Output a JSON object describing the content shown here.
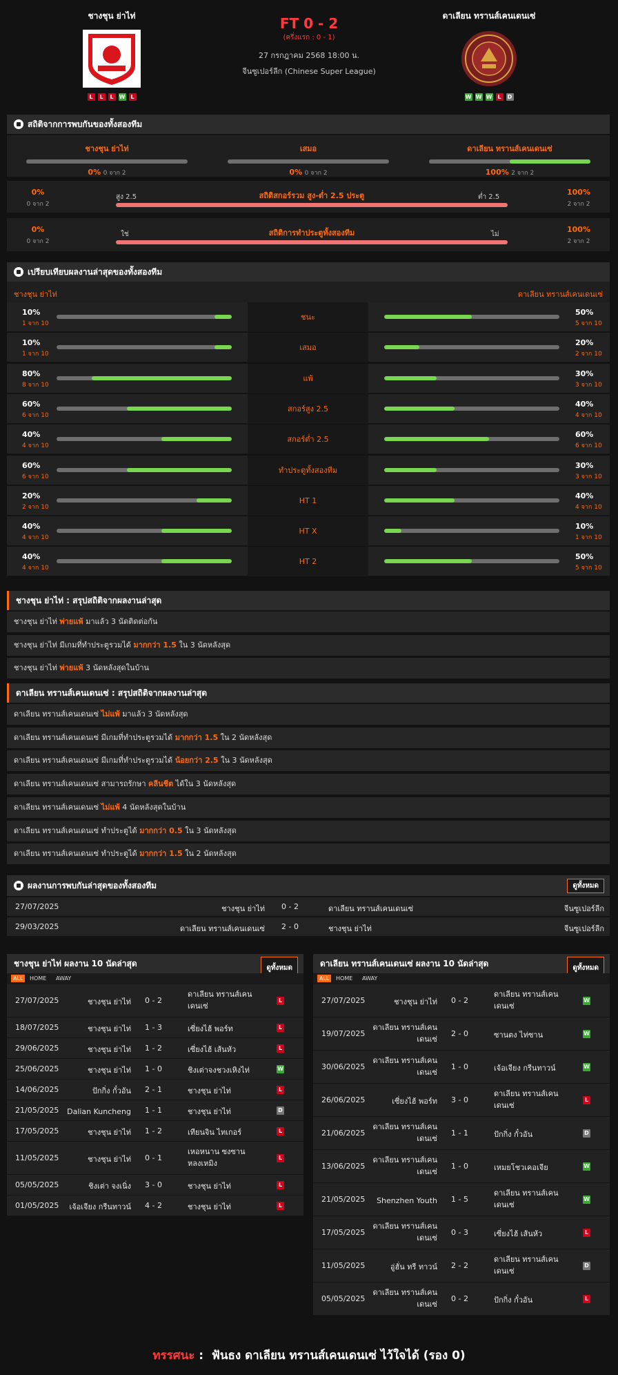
{
  "header": {
    "home": "ชางชุน ย่าไท่",
    "away": "ดาเลียน ทรานส์เคนเดนเซ่",
    "score": "FT 0 - 2",
    "half": "(ครึ่งแรก : 0 - 1)",
    "date": "27 กรกฎาคม 2568 18:00 น.",
    "league": "จีนซูเปอร์ลีก (Chinese Super League)",
    "home_form": [
      "L",
      "L",
      "L",
      "W",
      "L"
    ],
    "away_form": [
      "W",
      "W",
      "W",
      "L",
      "D"
    ],
    "home_logo_text": "CHANGCHUN YATAI FOOTBALL CLUB · 长春亚泰 · 1996",
    "away_logo_text": "大连英博海发足球俱乐部 · DALIAN YINGBO FC · 2021"
  },
  "h2h_stats": {
    "title": "สถิติจากการพบกันของทั้งสองทีม",
    "home": "ชางชุน ย่าไท่",
    "draw": "เสมอ",
    "away": "ดาเลียน ทรานส์เคนเดนเซ่",
    "home_pct": "0%",
    "home_sub": "0 จาก 2",
    "draw_pct": "0%",
    "draw_sub": "0 จาก 2",
    "away_pct": "100%",
    "away_sub": "2 จาก 2",
    "home_val": 0,
    "draw_val": 0,
    "away_val": 1,
    "ou_title": "สถิติสกอร์รวม สูง-ต่ำ 2.5 ประตู",
    "ou_left": "สูง 2.5",
    "ou_right": "ต่ำ 2.5",
    "ou_lpct": "0%",
    "ou_lsub": "0 จาก 2",
    "ou_rpct": "100%",
    "ou_rsub": "2 จาก 2",
    "ou_val": 1,
    "bt_title": "สถิติการทำประตูทั้งสองทีม",
    "bt_left": "ใช่",
    "bt_right": "ไม่",
    "bt_lpct": "0%",
    "bt_lsub": "0 จาก 2",
    "bt_rpct": "100%",
    "bt_rsub": "2 จาก 2",
    "bt_val": 1
  },
  "compare": {
    "title": "เปรียบเทียบผลงานล่าสุดของทั้งสองทีม",
    "home": "ชางชุน ย่าไท่",
    "away": "ดาเลียน ทรานส์เคนเดนเซ่",
    "rows": [
      {
        "label": "ชนะ",
        "lp": "10%",
        "ls": "1 จาก 10",
        "rp": "50%",
        "rs": "5 จาก 10",
        "lv": 0.1,
        "rv": 0.5
      },
      {
        "label": "เสมอ",
        "lp": "10%",
        "ls": "1 จาก 10",
        "rp": "20%",
        "rs": "2 จาก 10",
        "lv": 0.1,
        "rv": 0.2
      },
      {
        "label": "แพ้",
        "lp": "80%",
        "ls": "8 จาก 10",
        "rp": "30%",
        "rs": "3 จาก 10",
        "lv": 0.8,
        "rv": 0.3
      },
      {
        "label": "สกอร์สูง 2.5",
        "lp": "60%",
        "ls": "6 จาก 10",
        "rp": "40%",
        "rs": "4 จาก 10",
        "lv": 0.6,
        "rv": 0.4
      },
      {
        "label": "สกอร์ต่ำ 2.5",
        "lp": "40%",
        "ls": "4 จาก 10",
        "rp": "60%",
        "rs": "6 จาก 10",
        "lv": 0.4,
        "rv": 0.6
      },
      {
        "label": "ทำประตูทั้งสองทีม",
        "lp": "60%",
        "ls": "6 จาก 10",
        "rp": "30%",
        "rs": "3 จาก 10",
        "lv": 0.6,
        "rv": 0.3
      },
      {
        "label": "HT 1",
        "lp": "20%",
        "ls": "2 จาก 10",
        "rp": "40%",
        "rs": "4 จาก 10",
        "lv": 0.2,
        "rv": 0.4
      },
      {
        "label": "HT X",
        "lp": "40%",
        "ls": "4 จาก 10",
        "rp": "10%",
        "rs": "1 จาก 10",
        "lv": 0.4,
        "rv": 0.1
      },
      {
        "label": "HT 2",
        "lp": "40%",
        "ls": "4 จาก 10",
        "rp": "50%",
        "rs": "5 จาก 10",
        "lv": 0.4,
        "rv": 0.5
      }
    ]
  },
  "home_summary": {
    "title": "ชางชุน ย่าไท่ : สรุปสถิติจากผลงานล่าสุด",
    "rows": [
      [
        "ชางชุน ย่าไท่ ",
        "พ่ายแพ้",
        " มาแล้ว 3 นัดติดต่อกัน"
      ],
      [
        "ชางชุน ย่าไท่ มีเกมที่ทำประตูรวมได้ ",
        "มากกว่า 1.5",
        " ใน 3 นัดหลังสุด"
      ],
      [
        "ชางชุน ย่าไท่ ",
        "พ่ายแพ้",
        " 3 นัดหลังสุดในบ้าน"
      ]
    ]
  },
  "away_summary": {
    "title": "ดาเลียน ทรานส์เคนเดนเซ่ : สรุปสถิติจากผลงานล่าสุด",
    "rows": [
      [
        "ดาเลียน ทรานส์เคนเดนเซ่ ",
        "ไม่แพ้",
        " มาแล้ว 3 นัดหลังสุด"
      ],
      [
        "ดาเลียน ทรานส์เคนเดนเซ่ มีเกมที่ทำประตูรวมได้ ",
        "มากกว่า 1.5",
        " ใน 2 นัดหลังสุด"
      ],
      [
        "ดาเลียน ทรานส์เคนเดนเซ่ มีเกมที่ทำประตูรวมได้ ",
        "น้อยกว่า 2.5",
        " ใน 3 นัดหลังสุด"
      ],
      [
        "ดาเลียน ทรานส์เคนเดนเซ่ สามารถรักษา ",
        "คลีนชีต",
        " ได้ใน 3 นัดหลังสุด"
      ],
      [
        "ดาเลียน ทรานส์เคนเดนเซ่ ",
        "ไม่แพ้",
        " 4 นัดหลังสุดในบ้าน"
      ],
      [
        "ดาเลียน ทรานส์เคนเดนเซ่ ทำประตูได้ ",
        "มากกว่า 0.5",
        " ใน 3 นัดหลังสุด"
      ],
      [
        "ดาเลียน ทรานส์เคนเดนเซ่ ทำประตูได้ ",
        "มากกว่า 1.5",
        " ใน 2 นัดหลังสุด"
      ]
    ]
  },
  "h2h": {
    "title": "ผลงานการพบกันล่าสุดของทั้งสองทีม",
    "view_all": "ดูทั้งหมด",
    "rows": [
      [
        "27/07/2025",
        "ชางชุน ย่าไท่",
        "0 - 2",
        "ดาเลียน ทรานส์เคนเดนเซ่",
        "จีนซูเปอร์ลีก"
      ],
      [
        "29/03/2025",
        "ดาเลียน ทรานส์เคนเดนเซ่",
        "2 - 0",
        "ชางชุน ย่าไท่",
        "จีนซูเปอร์ลีก"
      ]
    ]
  },
  "tabs": [
    "ALL",
    "HOME",
    "AWAY"
  ],
  "home_last": {
    "title": "ชางชุน ย่าไท่ ผลงาน 10 นัดล่าสุด",
    "view_all": "ดูทั้งหมด",
    "rows": [
      [
        "27/07/2025",
        "ชางชุน ย่าไท่",
        "0 - 2",
        "ดาเลียน ทรานส์เคน|เดนเซ่",
        "L"
      ],
      [
        "18/07/2025",
        "ชางชุน ย่าไท่",
        "1 - 3",
        "เซี่ยงไฮ้ พอร์ท",
        "L"
      ],
      [
        "29/06/2025",
        "ชางชุน ย่าไท่",
        "1 - 2",
        "เซี่ยงไฮ้ เส้นหัว",
        "L"
      ],
      [
        "25/06/2025",
        "ชางชุน ย่าไท่",
        "1 - 0",
        "ชิงเต่าจงชวงเหิงไท่",
        "W"
      ],
      [
        "14/06/2025",
        "ปักกิ่ง กั๋วอัน",
        "2 - 1",
        "ชางชุน ย่าไท่",
        "L"
      ],
      [
        "21/05/2025",
        "Dalian Kuncheng",
        "1 - 1",
        "ชางชุน ย่าไท่",
        "D"
      ],
      [
        "17/05/2025",
        "ชางชุน ย่าไท่",
        "1 - 2",
        "เทียนจิน ไทเกอร์",
        "L"
      ],
      [
        "11/05/2025",
        "ชางชุน ย่าไท่",
        "0 - 1",
        "เหอหนาน ซงซาน|หลงเหมิง",
        "L"
      ],
      [
        "05/05/2025",
        "ชิงเต่า จงเนิ่ง",
        "3 - 0",
        "ชางชุน ย่าไท่",
        "L"
      ],
      [
        "01/05/2025",
        "เจ้อเจียง กรีนทาวน์",
        "4 - 2",
        "ชางชุน ย่าไท่",
        "L"
      ]
    ]
  },
  "away_last": {
    "title": "ดาเลียน ทรานส์เคนเดนเซ่ ผลงาน 10 นัดล่าสุด",
    "view_all": "ดูทั้งหมด",
    "rows": [
      [
        "27/07/2025",
        "ชางชุน ย่าไท่",
        "0 - 2",
        "ดาเลียน ทรานส์เคน|เดนเซ่",
        "W"
      ],
      [
        "19/07/2025",
        "ดาเลียน ทรานส์เคน|เดนเซ่",
        "2 - 0",
        "ซานตง ไท่ซาน",
        "W"
      ],
      [
        "30/06/2025",
        "ดาเลียน ทรานส์เคน|เดนเซ่",
        "1 - 0",
        "เจ้อเจียง กรีนทาวน์",
        "W"
      ],
      [
        "26/06/2025",
        "เซี่ยงไฮ้ พอร์ท",
        "3 - 0",
        "ดาเลียน ทรานส์เคน|เดนเซ่",
        "L"
      ],
      [
        "21/06/2025",
        "ดาเลียน ทรานส์เคน|เดนเซ่",
        "1 - 1",
        "ปักกิ่ง กั๋วอัน",
        "D"
      ],
      [
        "13/06/2025",
        "ดาเลียน ทรานส์เคน|เดนเซ่",
        "1 - 0",
        "เหมยโชวเคอเจีย",
        "W"
      ],
      [
        "21/05/2025",
        "Shenzhen Youth",
        "1 - 5",
        "ดาเลียน ทรานส์เคน|เดนเซ่",
        "W"
      ],
      [
        "17/05/2025",
        "ดาเลียน ทรานส์เคน|เดนเซ่",
        "0 - 3",
        "เซี่ยงไฮ้ เส้นหัว",
        "L"
      ],
      [
        "11/05/2025",
        "อู่ฮั่น ทรี ทาวน์",
        "2 - 2",
        "ดาเลียน ทรานส์เคน|เดนเซ่",
        "D"
      ],
      [
        "05/05/2025",
        "ดาเลียน ทรานส์เคน|เดนเซ่",
        "0 - 2",
        "ปักกิ่ง กั๋วอัน",
        "L"
      ]
    ]
  },
  "tip": {
    "label": "ทรรศนะ",
    "text": "ฟันธง ดาเลียน ทรานส์เคนเดนเซ่ ไว้ใจได้ (รอง 0)"
  },
  "colors": {
    "accent": "#ff6a13",
    "win": "#3aaa35",
    "loss": "#d0021b",
    "draw": "#777777",
    "bar_green": "#79d64f",
    "bar_red": "#f07472"
  }
}
